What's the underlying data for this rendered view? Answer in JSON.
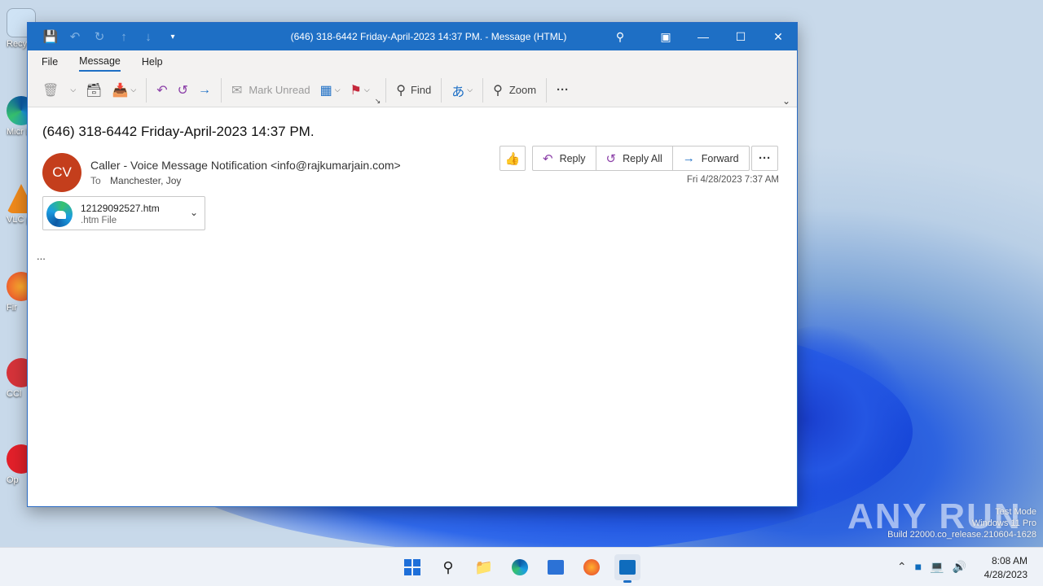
{
  "window": {
    "title": "(646) 318-6442 Friday-April-2023 14:37 PM.  -  Message (HTML)"
  },
  "menu": {
    "file": "File",
    "message": "Message",
    "help": "Help"
  },
  "ribbon": {
    "mark_unread": "Mark Unread",
    "find": "Find",
    "zoom": "Zoom",
    "more": "···"
  },
  "message": {
    "subject": "(646) 318-6442 Friday-April-2023 14:37 PM.",
    "avatar_initials": "CV",
    "sender": "Caller - Voice Message Notification <info@rajkumarjain.com>",
    "to_label": "To",
    "to": "Manchester, Joy",
    "date": "Fri 4/28/2023 7:37 AM",
    "body": "...",
    "avatar_color": "#c43e1c"
  },
  "actions": {
    "reply": "Reply",
    "reply_all": "Reply All",
    "forward": "Forward",
    "more": "···"
  },
  "attachment": {
    "name": "12129092527.htm",
    "type": ".htm File"
  },
  "desktop": {
    "icons": [
      "Recy",
      "Micr Ed",
      "VLC pla",
      "Fir",
      "CCl",
      "Op"
    ]
  },
  "taskbar": {
    "time": "8:08 AM",
    "date": "4/28/2023"
  },
  "watermark": {
    "brand": "ANY RUN",
    "line1": "Test Mode",
    "line2": "Windows 11 Pro",
    "line3": "Build 22000.co_release.210604-1628"
  },
  "colors": {
    "accent": "#1e6fc5",
    "reply_icon": "#8b3fa8",
    "forward_icon": "#1e6fc5"
  }
}
